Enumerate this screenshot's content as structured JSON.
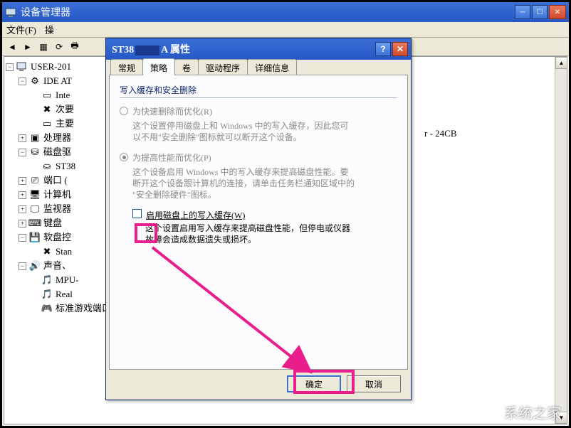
{
  "main": {
    "title": "设备管理器",
    "menu": {
      "file": "文件(F)",
      "action": "操"
    },
    "tree": {
      "root": "USER-201",
      "ide": "IDE AT",
      "ide_children": {
        "intel": "Inte",
        "secondary": "次要",
        "primary": "主要"
      },
      "cpu": "处理器",
      "disk_drives": "磁盘驱",
      "disk_item": "ST38",
      "ports": "端口 (",
      "computer": "计算机",
      "monitor": "监视器",
      "keyboard": "键盘",
      "floppy": "软盘控",
      "floppy_item": "Stan",
      "sound": "声音、",
      "sound_mpu": "MPU-",
      "sound_real": "Real",
      "sound_game": "标准游戏端口",
      "right_text": "r - 24CB"
    }
  },
  "dialog": {
    "title_prefix": "ST38",
    "title_suffix": "A 属性",
    "tabs": {
      "general": "常规",
      "policy": "策略",
      "volume": "卷",
      "driver": "驱动程序",
      "details": "详细信息"
    },
    "group_title": "写入缓存和安全删除",
    "opt1_label": "为快速删除而优化(R)",
    "opt1_desc1": "这个设置停用磁盘上和 Windows 中的写入缓存，因此您可",
    "opt1_desc2": "以不用\"安全删除\"图标就可以断开这个设备。",
    "opt2_label": "为提高性能而优化(P)",
    "opt2_desc1": "这个设备启用 Windows 中的写入缓存来提高磁盘性能。要",
    "opt2_desc2": "断开这个设备跟计算机的连接，请单击任务栏通知区域中的",
    "opt2_desc3": "\"安全删除硬件\"图标。",
    "check_label": "启用磁盘上的写入缓存(W)",
    "check_desc1": "这个设置启用写入缓存来提高磁盘性能，但停电或仪器",
    "check_desc2": "故障会造成数据遗失或损坏。",
    "ok": "确定",
    "cancel": "取消"
  },
  "watermark": "系统之家"
}
